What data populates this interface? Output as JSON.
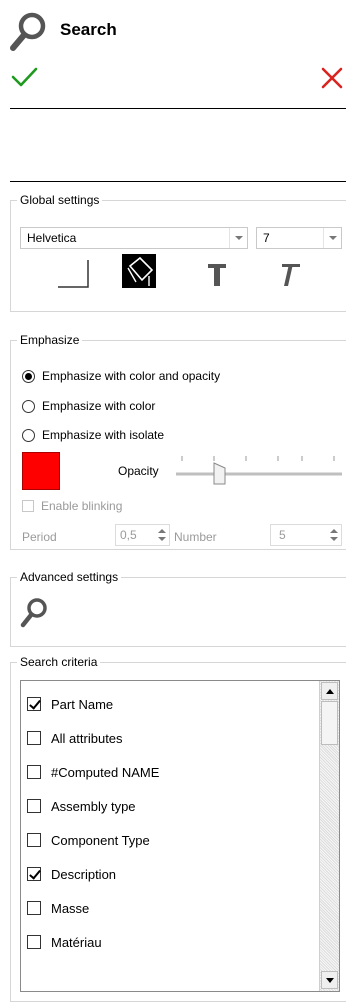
{
  "header": {
    "title": "Search",
    "icon": "magnifier-icon",
    "ok_icon": "checkmark-icon",
    "cancel_icon": "close-icon",
    "ok_color": "#1e9a1e",
    "cancel_color": "#d9231f"
  },
  "global_settings": {
    "label": "Global settings",
    "font": "Helvetica",
    "font_size": "7",
    "icons": [
      "frame-icon",
      "fill-color-icon",
      "bold-text-icon",
      "italic-text-icon"
    ]
  },
  "emphasize": {
    "label": "Emphasize",
    "options": [
      {
        "label": "Emphasize with color and opacity",
        "selected": true
      },
      {
        "label": "Emphasize with color",
        "selected": false
      },
      {
        "label": "Emphasize with isolate",
        "selected": false
      }
    ],
    "color": "#ff0000",
    "opacity_label": "Opacity",
    "opacity_value": 0.3,
    "blinking_label": "Enable blinking",
    "blinking_enabled": false,
    "period_label": "Period",
    "period_value": "0,5",
    "number_label": "Number",
    "number_value": "5"
  },
  "advanced_settings": {
    "label": "Advanced settings",
    "icon": "magnifier-icon"
  },
  "search_criteria": {
    "label": "Search criteria",
    "items": [
      {
        "label": "Part Name",
        "checked": true
      },
      {
        "label": "All attributes",
        "checked": false
      },
      {
        "label": "#Computed NAME",
        "checked": false
      },
      {
        "label": "Assembly type",
        "checked": false
      },
      {
        "label": "Component Type",
        "checked": false
      },
      {
        "label": "Description",
        "checked": true
      },
      {
        "label": "Masse",
        "checked": false
      },
      {
        "label": "Matériau",
        "checked": false
      }
    ]
  }
}
